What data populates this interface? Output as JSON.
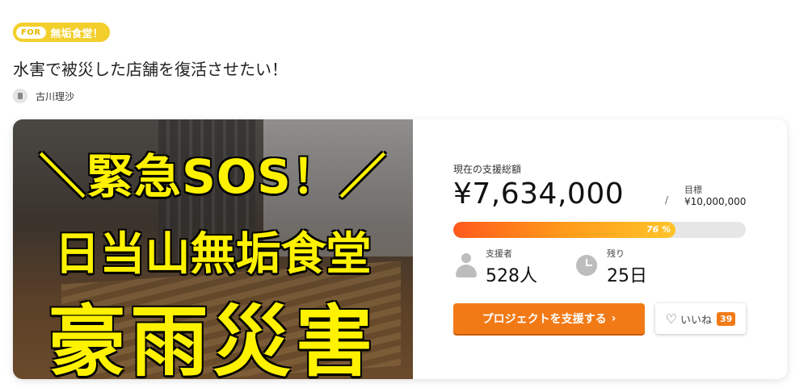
{
  "tag": {
    "prefix": "FOR",
    "name": "無垢食堂！"
  },
  "project": {
    "title": "水害で被災した店舗を復活させたい！"
  },
  "owner": {
    "name": "古川理沙"
  },
  "hero": {
    "line1": "＼緊急SOS！／",
    "line2": "日当山無垢食堂",
    "line3": "豪雨災害"
  },
  "funding": {
    "total_label": "現在の支援総額",
    "total_amount": "¥7,634,000",
    "separator": "/",
    "target_label": "目標",
    "target_amount": "¥10,000,000",
    "progress_percent": 76,
    "progress_text": "76 %"
  },
  "supporters": {
    "label": "支援者",
    "value": "528人"
  },
  "remaining": {
    "label": "残り",
    "value": "25日"
  },
  "actions": {
    "support_button": "プロジェクトを支援する",
    "support_chevron": "›",
    "like_label": "いいね",
    "like_count": "39"
  },
  "colors": {
    "accent": "#f27a16",
    "tag": "#f2cf2b",
    "hero_text": "#fff200"
  },
  "icons": {
    "supporters": "person-icon",
    "remaining": "clock-icon",
    "like": "heart-icon"
  }
}
